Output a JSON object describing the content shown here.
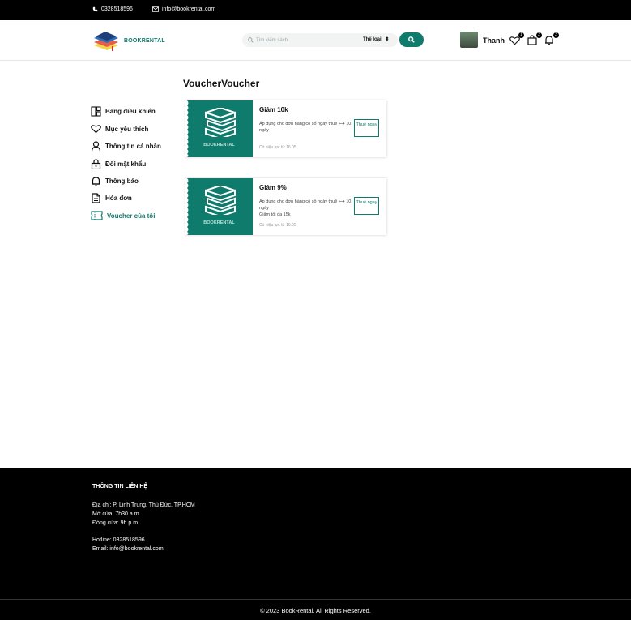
{
  "topbar": {
    "phone": "0328518596",
    "email": "info@bookrental.com"
  },
  "header": {
    "brand": "BOOKRENTAL",
    "search_placeholder": "Tìm kiếm sách",
    "category": "Thể loại",
    "username": "Thanh",
    "wishlist_count": "1",
    "cart_count": "2",
    "notify_count": "2"
  },
  "page": {
    "title": "VoucherVoucher"
  },
  "sidebar": {
    "items": [
      {
        "label": "Bảng điều khiển",
        "icon": "dashboard-icon"
      },
      {
        "label": "Mục yêu thích",
        "icon": "heart-icon"
      },
      {
        "label": "Thông tin cá nhân",
        "icon": "user-icon"
      },
      {
        "label": "Đổi mật khẩu",
        "icon": "lock-icon"
      },
      {
        "label": "Thông báo",
        "icon": "bell-icon"
      },
      {
        "label": "Hóa đơn",
        "icon": "invoice-icon"
      },
      {
        "label": "Voucher của tôi",
        "icon": "ticket-icon",
        "active": true
      }
    ]
  },
  "vouchers": [
    {
      "brand": "BOOKRENTAL",
      "title": "Giảm 10k",
      "desc": "Áp dụng cho đơn hàng có số ngày thuê ⟷ 10 ngày",
      "max": "",
      "expiry": "Có hiệu lực từ 16.05",
      "action": "Thuê ngay"
    },
    {
      "brand": "BOOKRENTAL",
      "title": "Giảm 9%",
      "desc": "Áp dụng cho đơn hàng có số ngày thuê ⟷ 10 ngày",
      "max": "Giảm tối đa 15k",
      "expiry": "Có hiệu lực từ 16.05",
      "action": "Thuê ngay"
    }
  ],
  "footer": {
    "heading": "THÔNG TIN LIÊN HỆ",
    "address": "Địa chỉ: P. Linh Trung, Thủ Đức, TP.HCM",
    "open": "Mở cửa: 7h30 a.m",
    "close": "Đóng cửa: 9h p.m",
    "hotline": "Hotline: 0328518596",
    "email": "Email: info@bookrental.com",
    "copyright": "© 2023 BookRental. All Rights Reserved."
  },
  "colors": {
    "accent": "#0f7b6c",
    "dark": "#000000"
  }
}
